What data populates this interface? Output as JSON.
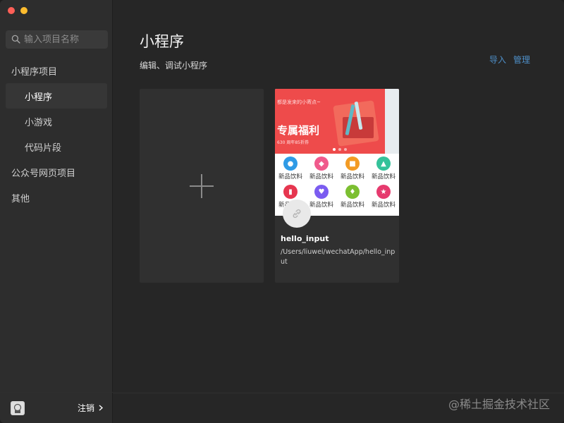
{
  "sidebar": {
    "search_placeholder": "输入项目名称",
    "items": [
      {
        "label": "小程序项目"
      },
      {
        "label": "小程序"
      },
      {
        "label": "小游戏"
      },
      {
        "label": "代码片段"
      },
      {
        "label": "公众号网页项目"
      },
      {
        "label": "其他"
      }
    ],
    "logout_label": "注销"
  },
  "main": {
    "title": "小程序",
    "subtitle": "编辑、调试小程序",
    "actions": {
      "import": "导入",
      "manage": "管理"
    },
    "project": {
      "name": "hello_input",
      "path": "/Users/liuwei/wechatApp/hello_input",
      "thumbnail": {
        "banner_small": "都是发来的小寄点~",
        "banner_big": "专属福利",
        "banner_tiny": "630 周年85折券",
        "grid_labels": [
          "新品饮料",
          "新品饮料",
          "新品饮料",
          "新品饮料",
          "新品饮料",
          "新品饮料",
          "新品饮料",
          "新品饮料"
        ],
        "grid_colors": [
          "#2f9be6",
          "#f05a8c",
          "#f39b24",
          "#34c29a",
          "#e6364f",
          "#7b5cf0",
          "#7cbf31",
          "#e63a6e"
        ]
      }
    }
  },
  "watermark": "@稀土掘金技术社区",
  "colors": {
    "sidebar_bg": "#2d2d2d",
    "main_bg": "#262626",
    "card_bg": "#303030",
    "link": "#4e8fc8"
  }
}
